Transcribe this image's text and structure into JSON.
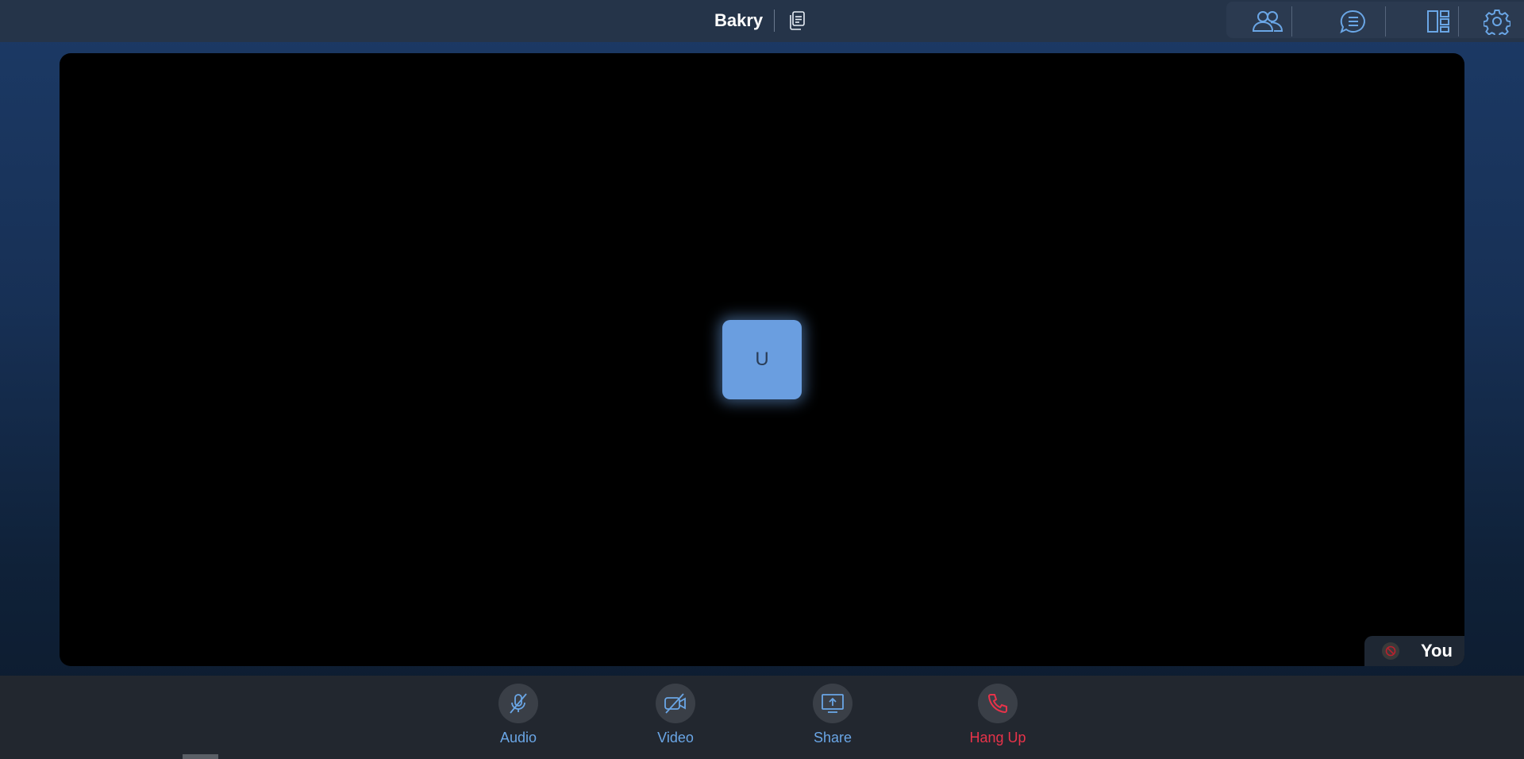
{
  "header": {
    "room_name": "Bakry"
  },
  "toolbar": {
    "icons": [
      "participants-icon",
      "chat-icon",
      "layout-icon",
      "settings-icon"
    ]
  },
  "stage": {
    "avatar_initial": "U",
    "self_label": "You"
  },
  "controls": {
    "audio_label": "Audio",
    "video_label": "Video",
    "share_label": "Share",
    "hangup_label": "Hang Up"
  },
  "colors": {
    "accent": "#6aa6e6",
    "danger": "#e8334a",
    "avatar": "#6a9ee0",
    "topbar": "#253449",
    "bottombar": "#22272f"
  }
}
